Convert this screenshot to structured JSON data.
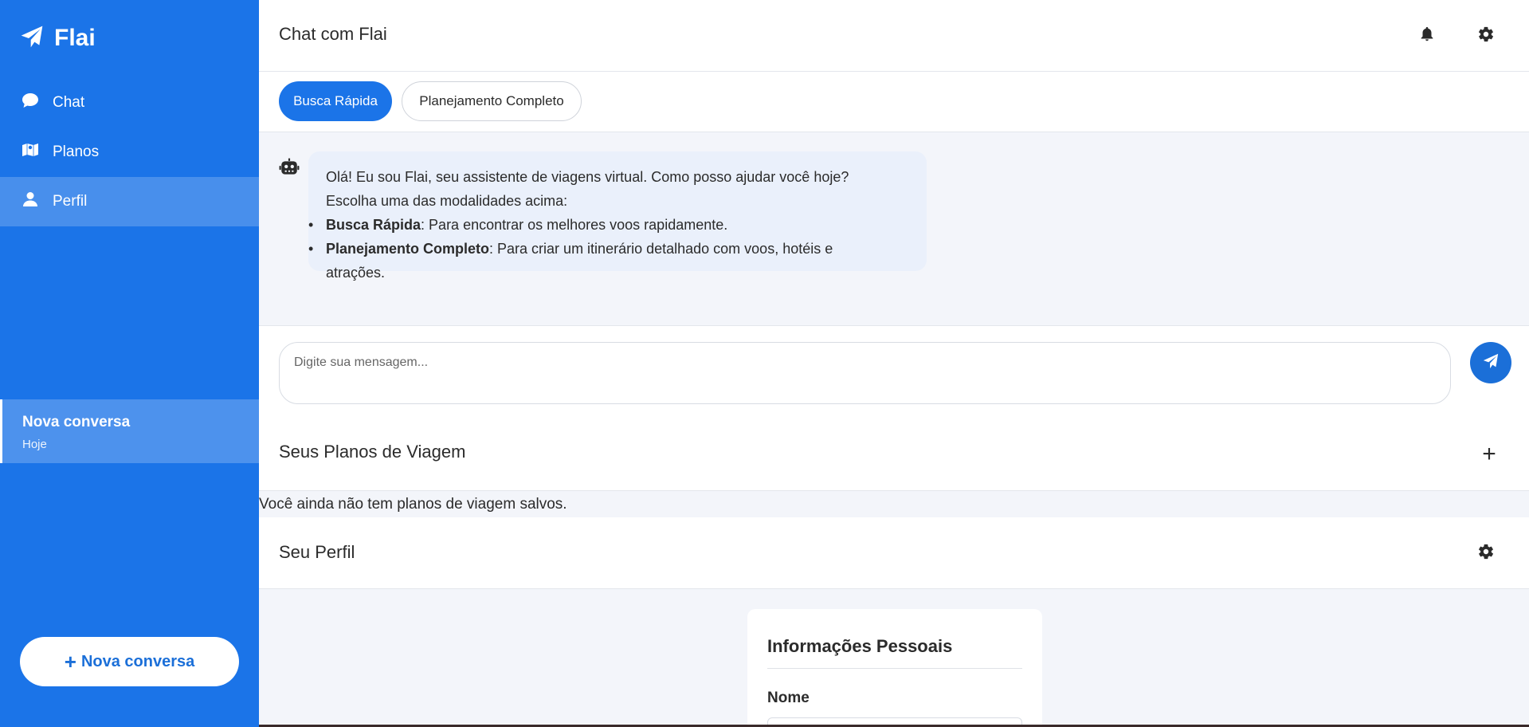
{
  "app": {
    "name": "Flai"
  },
  "sidebar": {
    "items": [
      {
        "label": "Chat",
        "icon": "chat-bubble-icon"
      },
      {
        "label": "Planos",
        "icon": "map-icon"
      },
      {
        "label": "Perfil",
        "icon": "user-icon",
        "active": true
      }
    ],
    "conversations": [
      {
        "title": "Nova conversa",
        "date": "Hoje"
      }
    ],
    "new_conversation_label": "Nova conversa",
    "background_color": "#1b74e8"
  },
  "header": {
    "title": "Chat com Flai",
    "icons": [
      "bell-icon",
      "gear-icon"
    ]
  },
  "modes": {
    "quick": "Busca Rápida",
    "full": "Planejamento Completo"
  },
  "chat": {
    "messages": [
      {
        "sender": "bot",
        "line1": "Olá! Eu sou Flai, seu assistente de viagens virtual. Como posso ajudar você hoje?",
        "line2": "Escolha uma das modalidades acima:",
        "options": [
          {
            "title": "Busca Rápida",
            "text": ": Para encontrar os melhores voos rapidamente."
          },
          {
            "title": "Planejamento Completo",
            "text": ": Para criar um itinerário detalhado com voos, hotéis e atrações."
          }
        ]
      }
    ],
    "input_placeholder": "Digite sua mensagem..."
  },
  "plans": {
    "title": "Seus Planos de Viagem",
    "empty_text": "Você ainda não tem planos de viagem salvos."
  },
  "profile": {
    "title": "Seu Perfil",
    "card_title": "Informações Pessoais",
    "name_label": "Nome"
  }
}
